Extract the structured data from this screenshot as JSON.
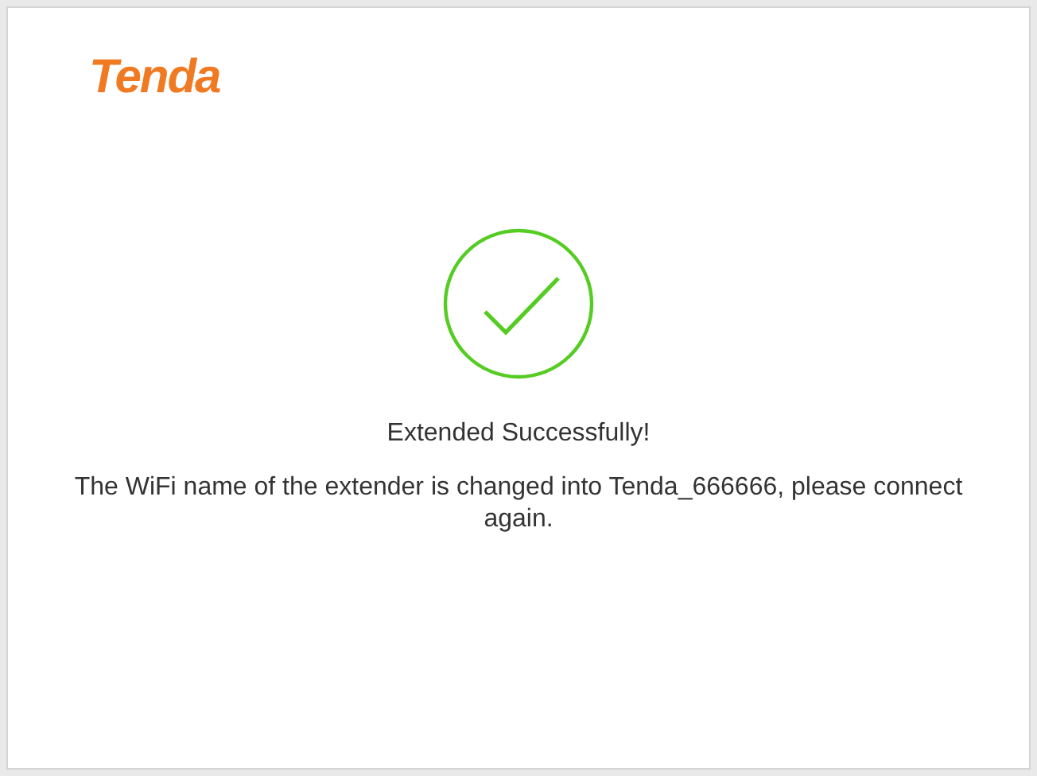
{
  "logo": "Tenda",
  "status": {
    "kind": "success",
    "title": "Extended Successfully!",
    "message": "The WiFi name of the extender is changed into Tenda_666666, please connect again."
  }
}
